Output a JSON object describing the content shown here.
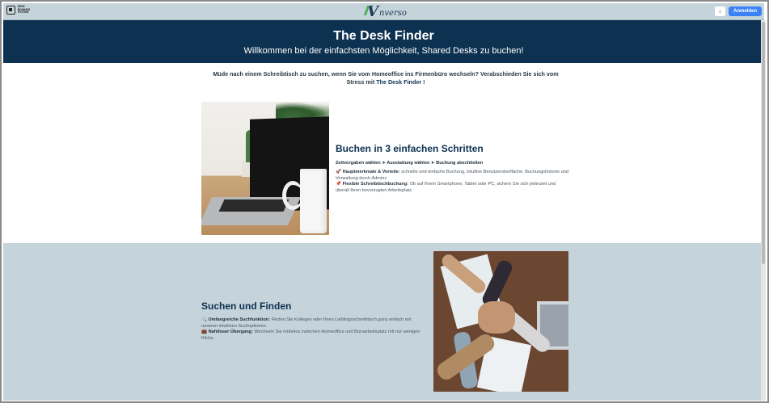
{
  "nav": {
    "left_logo_text": "DESK BOOKING SYSTEM",
    "brand_word": "nverso",
    "brand_letter": "V",
    "theme_icon": "sun-icon",
    "login_label": "Anmelden"
  },
  "hero": {
    "title": "The Desk Finder",
    "subtitle": "Willkommen bei der einfachsten Möglichkeit, Shared Desks zu buchen!"
  },
  "intro": {
    "text": "Müde nach einem Schreibtisch zu suchen, wenn Sie vom Homeoffice ins Firmenbüro wechseln? Verabschieden Sie sich vom Stress mit",
    "highlight": "The Desk Finder",
    "end": "!"
  },
  "section1": {
    "title": "Buchen in 3 einfachen Schritten",
    "steps": "Zeitvorgaben wählen ➤ Ausstattung wählen ➤ Buchung abschließen",
    "feature1_icon": "🚀",
    "feature1_title": "Hauptmerkmale & Vorteile:",
    "feature1_text": "schnelle und einfache Buchung, intuitive Benutzeroberfläche, Buchungshistorie und Verwaltung durch Admins",
    "feature2_icon": "📌",
    "feature2_title": "Flexible Schreibtischbuchung:",
    "feature2_text": "Ob auf Ihrem Smartphone, Tablet oder PC, sichern Sie sich jederzeit und überall Ihren bevorzugten Arbeitsplatz."
  },
  "section2": {
    "title": "Suchen und Finden",
    "feature1_icon": "🔍",
    "feature1_title": "Umfangreiche Suchfunktion:",
    "feature1_text": "Finden Sie Kollegen oder Ihren Lieblingsschreibtisch ganz einfach mit unseren intuitiven Suchoptionen.",
    "feature2_icon": "💼",
    "feature2_title": "Nahtloser Übergang:",
    "feature2_text": "Wechseln Sie mühelos zwischen Homeoffice und Büroarbeitsplatz mit nur wenigen Klicks."
  },
  "colors": {
    "navy": "#0d3150",
    "band": "#c5d3da",
    "accent_green": "#4caf50",
    "login_blue": "#3b82f6"
  }
}
